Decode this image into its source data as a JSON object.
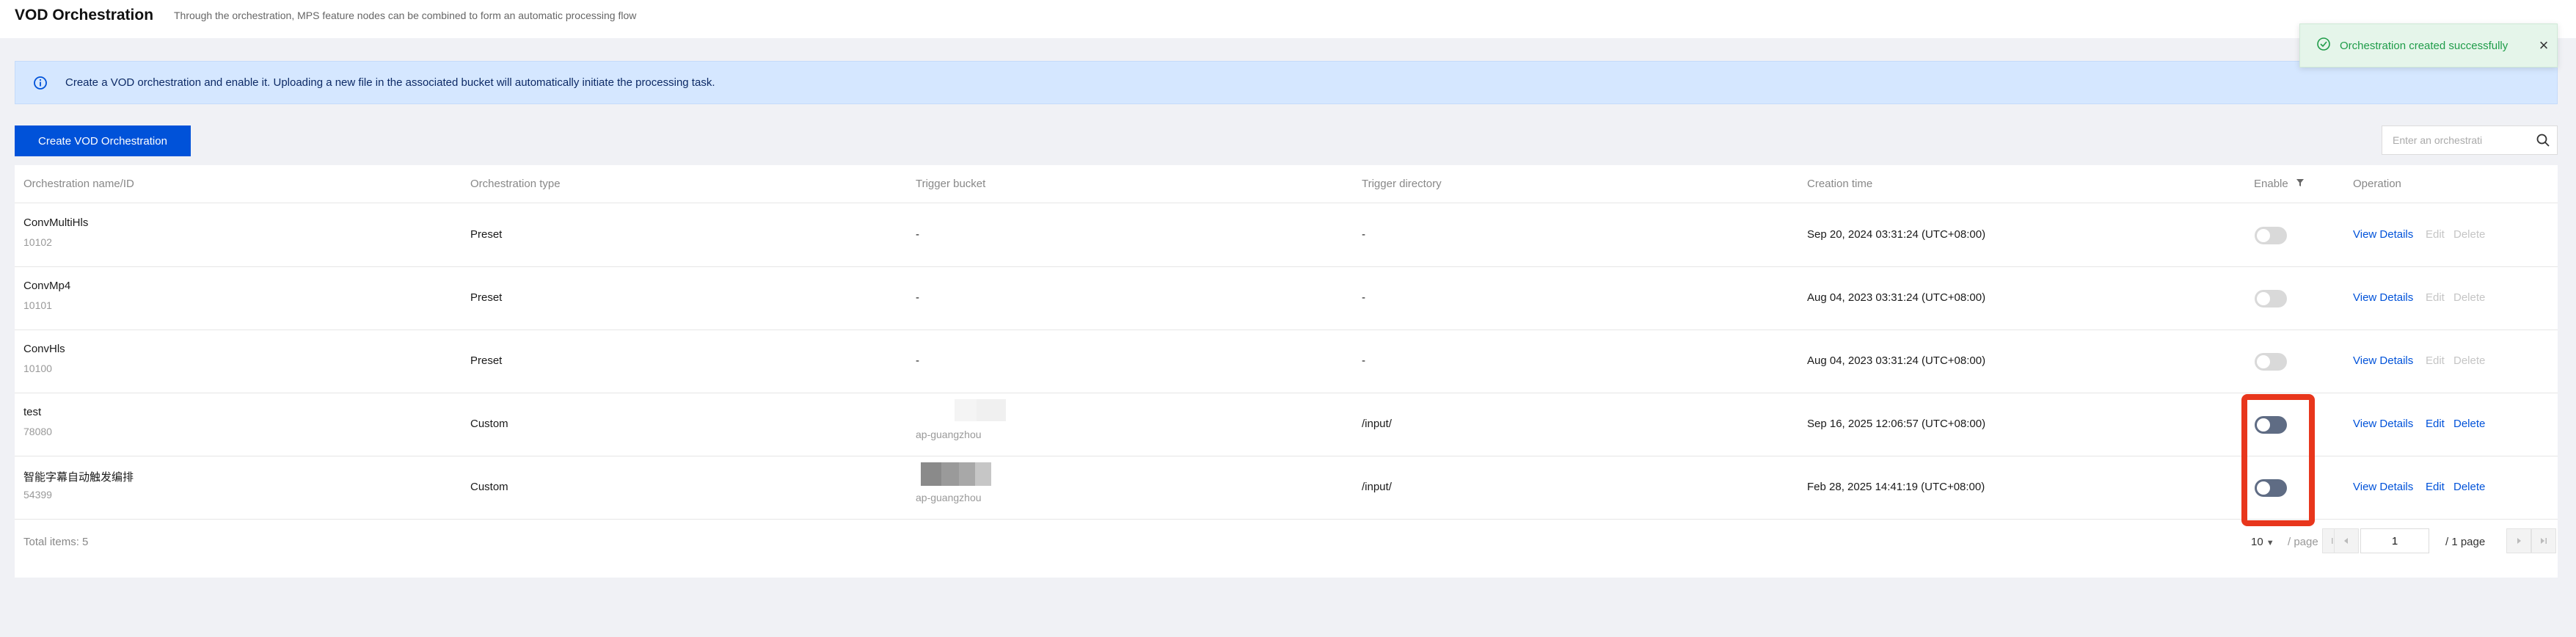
{
  "header": {
    "title": "VOD Orchestration",
    "description": "Through the orchestration, MPS feature nodes can be combined to form an automatic processing flow"
  },
  "banner": {
    "text": "Create a VOD orchestration and enable it. Uploading a new file in the associated bucket will automatically initiate the processing task."
  },
  "toolbar": {
    "create_label": "Create VOD Orchestration",
    "search_placeholder": "Enter an orchestrati"
  },
  "table": {
    "columns": {
      "name": "Orchestration name/ID",
      "type": "Orchestration type",
      "bucket": "Trigger bucket",
      "directory": "Trigger directory",
      "created": "Creation time",
      "enable": "Enable",
      "operation": "Operation"
    },
    "rows": [
      {
        "name": "ConvMultiHls",
        "id": "10102",
        "type": "Preset",
        "bucket": "-",
        "bucket_region": "",
        "directory": "-",
        "created": "Sep 20, 2024 03:31:24 (UTC+08:00)",
        "enabled": false
      },
      {
        "name": "ConvMp4",
        "id": "10101",
        "type": "Preset",
        "bucket": "-",
        "bucket_region": "",
        "directory": "-",
        "created": "Aug 04, 2023 03:31:24 (UTC+08:00)",
        "enabled": false
      },
      {
        "name": "ConvHls",
        "id": "10100",
        "type": "Preset",
        "bucket": "-",
        "bucket_region": "",
        "directory": "-",
        "created": "Aug 04, 2023 03:31:24 (UTC+08:00)",
        "enabled": false
      },
      {
        "name": "test",
        "id": "78080",
        "type": "Custom",
        "bucket": "",
        "bucket_region": "ap-guangzhou",
        "directory": "/input/",
        "created": "Sep 16, 2025 12:06:57 (UTC+08:00)",
        "enabled": false
      },
      {
        "name": "智能字幕自动触发编排",
        "id": "54399",
        "type": "Custom",
        "bucket": "",
        "bucket_region": "ap-guangzhou",
        "directory": "/input/",
        "created": "Feb 28, 2025 14:41:19 (UTC+08:00)",
        "enabled": false
      }
    ],
    "operations": {
      "view": "View Details",
      "edit": "Edit",
      "delete": "Delete"
    }
  },
  "pagination": {
    "total_label": "Total items:  5",
    "page_size": "10",
    "per_page_label": "/ page",
    "current_page": "1",
    "total_pages_label": "/ 1 page"
  },
  "toast": {
    "text": "Orchestration created successfully"
  },
  "colors": {
    "primary": "#0052d9",
    "banner_bg": "#d5e7ff",
    "toast_bg": "#e5f5ea",
    "success": "#1f9c49",
    "highlight": "#e8361c"
  }
}
